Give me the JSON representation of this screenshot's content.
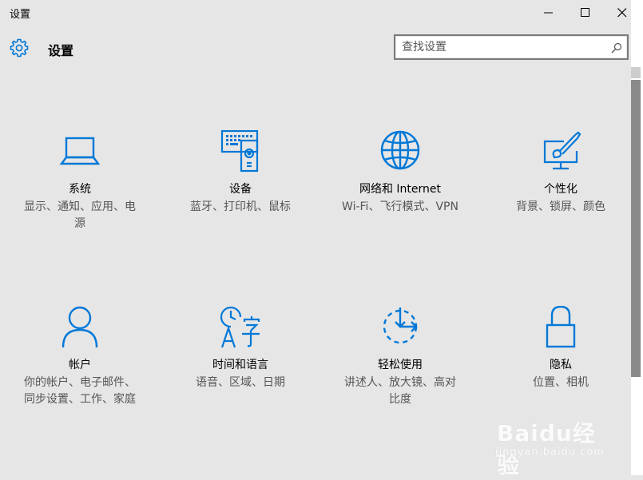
{
  "window": {
    "title": "设置"
  },
  "header": {
    "icon": "gear-icon",
    "title": "设置"
  },
  "search": {
    "placeholder": "查找设置",
    "value": "",
    "icon": "search-icon"
  },
  "tiles": [
    {
      "name": "系统",
      "desc_line1": "显示、通知、应用、电",
      "desc_line2": "源",
      "icon": "laptop-icon"
    },
    {
      "name": "设备",
      "desc_line1": "蓝牙、打印机、鼠标",
      "desc_line2": "",
      "icon": "devices-icon"
    },
    {
      "name": "网络和 Internet",
      "desc_line1": "Wi-Fi、飞行模式、VPN",
      "desc_line2": "",
      "icon": "globe-icon"
    },
    {
      "name": "个性化",
      "desc_line1": "背景、锁屏、颜色",
      "desc_line2": "",
      "icon": "personalization-icon"
    },
    {
      "name": "帐户",
      "desc_line1": "你的帐户、电子邮件、",
      "desc_line2": "同步设置、工作、家庭",
      "icon": "person-icon"
    },
    {
      "name": "时间和语言",
      "desc_line1": "语音、区域、日期",
      "desc_line2": "",
      "icon": "time-language-icon"
    },
    {
      "name": "轻松使用",
      "desc_line1": "讲述人、放大镜、高对",
      "desc_line2": "比度",
      "icon": "ease-of-access-icon"
    },
    {
      "name": "隐私",
      "desc_line1": "位置、相机",
      "desc_line2": "",
      "icon": "lock-icon"
    }
  ],
  "watermark": {
    "text": "Baidu经验",
    "subtext": "jingyan.baidu.com"
  },
  "colors": {
    "accent": "#0078d7",
    "background": "#e6e6e6"
  }
}
